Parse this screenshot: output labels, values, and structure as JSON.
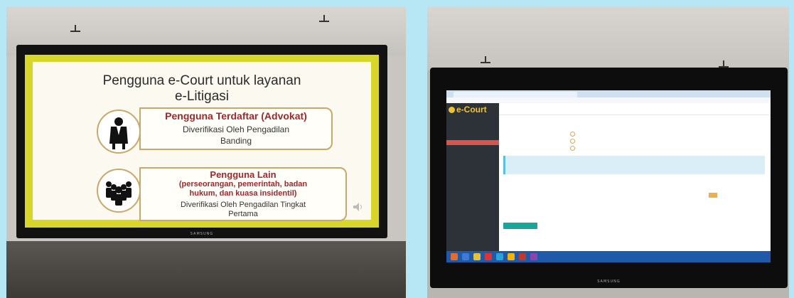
{
  "left_photo": {
    "slide": {
      "title_line1": "Pengguna e-Court untuk layanan",
      "title_line2": "e-Litigasi",
      "box1_title": "Pengguna Terdaftar (Advokat)",
      "box1_line1": "Diverifikasi Oleh Pengadilan",
      "box1_line2": "Banding",
      "box2_title": "Pengguna Lain",
      "box2_sub1": "(perseorangan, pemerintah, badan",
      "box2_sub2": "hukum, dan kuasa insidentil)",
      "box2_line1": "Diverifikasi Oleh Pengadilan Tingkat",
      "box2_line2": "Pertama"
    },
    "tv_brand": "SAMSUNG",
    "colors": {
      "slide_border": "#d8d629",
      "accent_red": "#a2272b",
      "frame_gold": "#c9a86a"
    }
  },
  "right_photo": {
    "screen": {
      "logo": "e-Court",
      "colors": {
        "sidebar": "#2c3238",
        "active_menu": "#d9534f",
        "save_button": "#18a59a",
        "doc_button": "#f0ad4e",
        "taskbar": "#1e5aa8"
      }
    },
    "tv_brand": "SAMSUNG"
  }
}
